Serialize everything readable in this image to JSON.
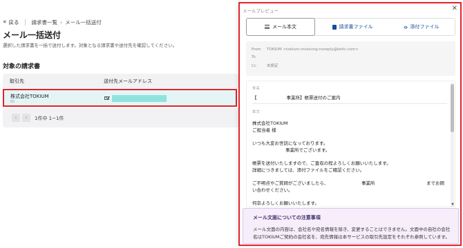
{
  "nav": {
    "back_icon": "double-chevron-left-icon",
    "back_label": "戻る",
    "breadcrumb_parent": "請求書一覧",
    "breadcrumb_separator": "›",
    "breadcrumb_current": "メール一括送付"
  },
  "page": {
    "title": "メール一括送付",
    "description": "選択した請求書を一括で送付します。対象となる請求書や送付先を確認してください。",
    "section_title": "対象の請求書"
  },
  "table": {
    "columns": [
      "取引先",
      "送付先メールアドレス"
    ],
    "rows": [
      {
        "client": "株式会社TOKIUM",
        "client_sub": "ID",
        "email_icon": "mail-icon",
        "email": ""
      }
    ],
    "pagination": {
      "prev_icon": "chevron-left-icon",
      "next_icon": "chevron-right-icon",
      "summary": "1件中 1~1件"
    }
  },
  "preview": {
    "title": "メールプレビュー",
    "close_icon": "close-icon",
    "tabs": [
      {
        "label": "メール本文",
        "icon": "text-lines-icon",
        "active": true
      },
      {
        "label": "請求書ファイル",
        "icon": "document-icon",
        "active": false
      },
      {
        "label": "添付ファイル",
        "icon": "paperclip-icon",
        "active": false
      }
    ],
    "header": {
      "from_label": "From",
      "from_value": "TOKIUM <tokium-invoicing-noreply@keihi.com>",
      "to_label": "To",
      "to_value": "",
      "cc_label": "Cc",
      "cc_value": "未設定"
    },
    "subject_label": "件名",
    "subject_prefix": "【",
    "subject_text": "事業所】帳票送付のご案内",
    "body_label": "本文",
    "body_lines": [
      "株式会社TOKIUM",
      "ご担当者 様",
      "いつも大変お世話になっております。",
      "事業所でございます。",
      "帳票を送付いたしますので、ご査収の程よろしくお願いいたします。",
      "詳細につきましては、添付ファイルをご確認ください。",
      "ご不明点やご質問がございましたら、",
      "事業所",
      "までお問",
      "い合わせください。",
      "何卒よろしくお願いいたします。"
    ],
    "notice": {
      "title": "メール文面についての注意事項",
      "lines": [
        "メール文面の内容は、会社名や宛名情報を除き、変更することはできません。文面中の自社の会社",
        "名はTOKIUMご契約の会社名を、宛先情報は本サービスの取引先設定をそれぞれ参照しています。"
      ]
    }
  }
}
